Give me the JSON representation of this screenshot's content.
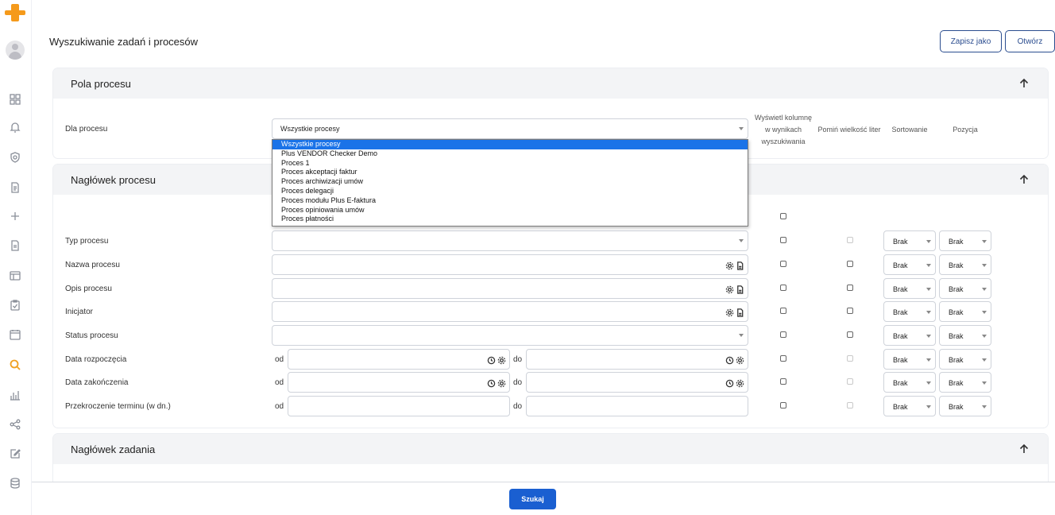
{
  "colors": {
    "accent": "#2b4d8f",
    "primary": "#1a5fd1",
    "logo": "#f59a1b",
    "active_nav": "#f0a020"
  },
  "page": {
    "title": "Wyszukiwanie zadań i procesów"
  },
  "toolbar": {
    "save_as_label": "Zapisz jako",
    "open_label": "Otwórz"
  },
  "sidebar": {
    "icons": [
      "logo-icon",
      "avatar",
      "dashboard-icon",
      "bell-icon",
      "shield-icon",
      "document-list-icon",
      "plus-icon",
      "document-icon",
      "layout-icon",
      "clipboard-check-icon",
      "calendar-icon",
      "search-icon",
      "bar-chart-icon",
      "share-icon",
      "edit-icon",
      "database-icon"
    ]
  },
  "pola_procesu": {
    "title": "Pola procesu",
    "dla_procesu_label": "Dla procesu",
    "dla_procesu_value": "Wszystkie procesy",
    "col_display": "Wyświetl kolumnę w wynikach wyszukiwania",
    "col_display_1": "Wyświetl kolumnę",
    "col_display_2": "w wynikach",
    "col_display_3": "wyszukiwania",
    "col_ignore_case": "Pomiń wielkość liter",
    "col_sort": "Sortowanie",
    "col_position": "Pozycja"
  },
  "dropdown": {
    "options": [
      "Wszystkie procesy",
      "Plus VENDOR Checker Demo",
      "Proces 1",
      "Proces akceptacji faktur",
      "Proces archiwizacji umów",
      "Proces delegacji",
      "Proces modułu Plus E-faktura",
      "Proces opiniowania umów",
      "Proces płatności"
    ],
    "selected": "Wszystkie procesy"
  },
  "naglowek_procesu": {
    "title": "Nagłówek procesu",
    "rows": [
      {
        "label": "Typ procesu",
        "sort": "Brak",
        "position": "Brak"
      },
      {
        "label": "Nazwa procesu",
        "sort": "Brak",
        "position": "Brak"
      },
      {
        "label": "Opis procesu",
        "sort": "Brak",
        "position": "Brak"
      },
      {
        "label": "Inicjator",
        "sort": "Brak",
        "position": "Brak"
      },
      {
        "label": "Status procesu",
        "sort": "Brak",
        "position": "Brak"
      },
      {
        "label": "Data rozpoczęcia",
        "sort": "Brak",
        "position": "Brak"
      },
      {
        "label": "Data zakończenia",
        "sort": "Brak",
        "position": "Brak"
      },
      {
        "label": "Przekroczenie terminu (w dn.)",
        "sort": "Brak",
        "position": "Brak"
      }
    ],
    "od_label": "od",
    "do_label": "do"
  },
  "naglowek_zadania": {
    "title": "Nagłówek zadania"
  },
  "footer": {
    "search_label": "Szukaj"
  }
}
